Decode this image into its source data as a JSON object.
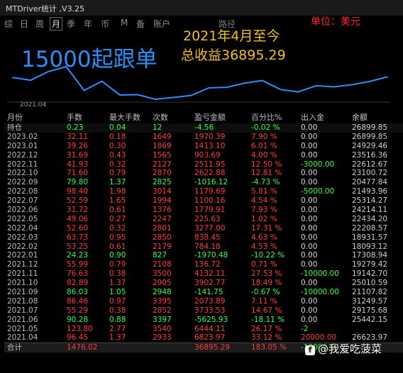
{
  "window": {
    "title": "MTDriver统计 ,V3.25"
  },
  "tabs": [
    "综",
    "日",
    "周",
    "月",
    "季",
    "年",
    "币",
    "M",
    "备",
    "账户"
  ],
  "active_tab": "月",
  "path_label": "路径",
  "unit_label": "单位：美元",
  "chart_overlay": {
    "headline": "15000起跟单",
    "since": "2021年4月至今",
    "total": "总收益36895.29"
  },
  "chart_data": {
    "type": "line",
    "x": [
      "2021.04",
      "2021.05",
      "2021.06",
      "2021.07",
      "2021.08",
      "2021.09",
      "2021.10",
      "2021.11",
      "2021.12",
      "2022.01",
      "2022.02",
      "2022.03",
      "2022.04",
      "2022.05",
      "2022.06",
      "2022.07",
      "2022.08",
      "2022.09",
      "2022.10",
      "2022.11",
      "2022.12",
      "2023.01",
      "2023.02"
    ],
    "values": [
      26623.97,
      25442.15,
      29175.68,
      31249.57,
      21107.82,
      25010.59,
      19142.7,
      19279.42,
      17308.94,
      18093.12,
      18931.57,
      22208.57,
      22434.2,
      24214.11,
      25314.27,
      21493.96,
      20477.84,
      23100.72,
      22612.67,
      23516.36,
      24929.46,
      26899.85
    ],
    "x_start_label": "2021.04",
    "line_color": "#2a8ff7"
  },
  "table": {
    "headers": [
      "月份",
      "手数",
      "最大手数",
      "次数",
      "盈亏金额",
      "百分比%",
      "出入金",
      "余额"
    ],
    "holding": {
      "label": "持仓",
      "lots": "0.23",
      "max": "0.04",
      "count": "12",
      "pnl": "-4.56",
      "pct": "-0.02 %",
      "flow": "0.00",
      "balance": "26899.85"
    },
    "rows": [
      {
        "m": "2023.02",
        "lots": "32.11",
        "max": "0.18",
        "count": "1649",
        "pnl": "1970.39",
        "pct": "7.90 %",
        "flow": "0.00",
        "balance": "26899.85",
        "pos": true
      },
      {
        "m": "2023.01",
        "lots": "39.26",
        "max": "0.30",
        "count": "1869",
        "pnl": "1413.10",
        "pct": "6.01 %",
        "flow": "0.00",
        "balance": "24929.46",
        "pos": true
      },
      {
        "m": "2022.12",
        "lots": "31.69",
        "max": "0.43",
        "count": "1565",
        "pnl": "903.69",
        "pct": "4.00 %",
        "flow": "0.00",
        "balance": "23516.36",
        "pos": true
      },
      {
        "m": "2022.11",
        "lots": "41.93",
        "max": "0.32",
        "count": "2127",
        "pnl": "2511.95",
        "pct": "12.50 %",
        "flow": "-3000.00",
        "balance": "22612.67",
        "pos": true
      },
      {
        "m": "2022.10",
        "lots": "71.60",
        "max": "0.79",
        "count": "2870",
        "pnl": "2622.88",
        "pct": "12.81 %",
        "flow": "0.00",
        "balance": "23100.72",
        "pos": true
      },
      {
        "m": "2022.09",
        "lots": "79.80",
        "max": "1.37",
        "count": "2825",
        "pnl": "-1016.12",
        "pct": "-4.73 %",
        "flow": "0.00",
        "balance": "20477.84",
        "pos": false
      },
      {
        "m": "2022.08",
        "lots": "98.40",
        "max": "1.98",
        "count": "3014",
        "pnl": "1179.69",
        "pct": "5.81 %",
        "flow": "-5000.00",
        "balance": "21493.96",
        "pos": true
      },
      {
        "m": "2022.07",
        "lots": "52.59",
        "max": "1.65",
        "count": "1994",
        "pnl": "1100.16",
        "pct": "4.54 %",
        "flow": "0.00",
        "balance": "25314.27",
        "pos": true
      },
      {
        "m": "2022.06",
        "lots": "31.72",
        "max": "0.61",
        "count": "1376",
        "pnl": "1779.91",
        "pct": "7.93 %",
        "flow": "0.00",
        "balance": "24214.11",
        "pos": true
      },
      {
        "m": "2022.05",
        "lots": "49.06",
        "max": "0.27",
        "count": "2247",
        "pnl": "225.63",
        "pct": "1.02 %",
        "flow": "0.00",
        "balance": "22434.20",
        "pos": true
      },
      {
        "m": "2022.04",
        "lots": "52.60",
        "max": "0.32",
        "count": "2801",
        "pnl": "3277.00",
        "pct": "17.31 %",
        "flow": "0.00",
        "balance": "22208.57",
        "pos": true
      },
      {
        "m": "2022.03",
        "lots": "63.73",
        "max": "0.95",
        "count": "2850",
        "pnl": "838.45",
        "pct": "4.63 %",
        "flow": "0.00",
        "balance": "18931.57",
        "pos": true
      },
      {
        "m": "2022.02",
        "lots": "53.25",
        "max": "0.61",
        "count": "2179",
        "pnl": "784.18",
        "pct": "4.53 %",
        "flow": "0.00",
        "balance": "18093.12",
        "pos": true
      },
      {
        "m": "2022.01",
        "lots": "24.23",
        "max": "0.90",
        "count": "827",
        "pnl": "-1970.48",
        "pct": "-10.22 %",
        "flow": "0.00",
        "balance": "17308.94",
        "pos": false
      },
      {
        "m": "2021.12",
        "lots": "55.99",
        "max": "0.79",
        "count": "2108",
        "pnl": "136.72",
        "pct": "0.71 %",
        "flow": "0.00",
        "balance": "19279.42",
        "pos": true
      },
      {
        "m": "2021.11",
        "lots": "76.63",
        "max": "0.38",
        "count": "3500",
        "pnl": "4132.11",
        "pct": "27.53 %",
        "flow": "-10000.00",
        "balance": "19142.70",
        "pos": true
      },
      {
        "m": "2021.10",
        "lots": "82.89",
        "max": "1.37",
        "count": "2905",
        "pnl": "3902.77",
        "pct": "18.49 %",
        "flow": "0.00",
        "balance": "25010.59",
        "pos": true
      },
      {
        "m": "2021.09",
        "lots": "86.03",
        "max": "1.05",
        "count": "2948",
        "pnl": "-141.75",
        "pct": "-0.67 %",
        "flow": "-10000.00",
        "balance": "21107.82",
        "pos": false
      },
      {
        "m": "2021.08",
        "lots": "86.46",
        "max": "0.97",
        "count": "3395",
        "pnl": "2073.89",
        "pct": "7.11 %",
        "flow": "0.00",
        "balance": "31249.57",
        "pos": true
      },
      {
        "m": "2021.07",
        "lots": "55.29",
        "max": "0.38",
        "count": "2852",
        "pnl": "3733.53",
        "pct": "14.67 %",
        "flow": "0.00",
        "balance": "29175.68",
        "pos": true
      },
      {
        "m": "2021.06",
        "lots": "90.28",
        "max": "0.88",
        "count": "3397",
        "pnl": "-5625.93",
        "pct": "-18.11 %",
        "flow": "0.00",
        "balance": "25442.15",
        "pos": false
      },
      {
        "m": "2021.05",
        "lots": "123.80",
        "max": "2.77",
        "count": "3540",
        "pnl": "6444.11",
        "pct": "26.17 %",
        "flow": "-2",
        "balance": "",
        "pos": true
      },
      {
        "m": "2021.04",
        "lots": "96.45",
        "max": "1.37",
        "count": "2933",
        "pnl": "6823.97",
        "pct": "33.12 %",
        "flow": "20000.00",
        "balance": "26623.97",
        "pos": true
      }
    ],
    "total": {
      "label": "合计",
      "lots": "1476.02",
      "pnl": "36895.29",
      "pct": "183.05 %",
      "flow": "-10000.00"
    }
  },
  "watermark": {
    "text": "@我爱吃菠菜",
    "icon": "app-logo-icon"
  }
}
